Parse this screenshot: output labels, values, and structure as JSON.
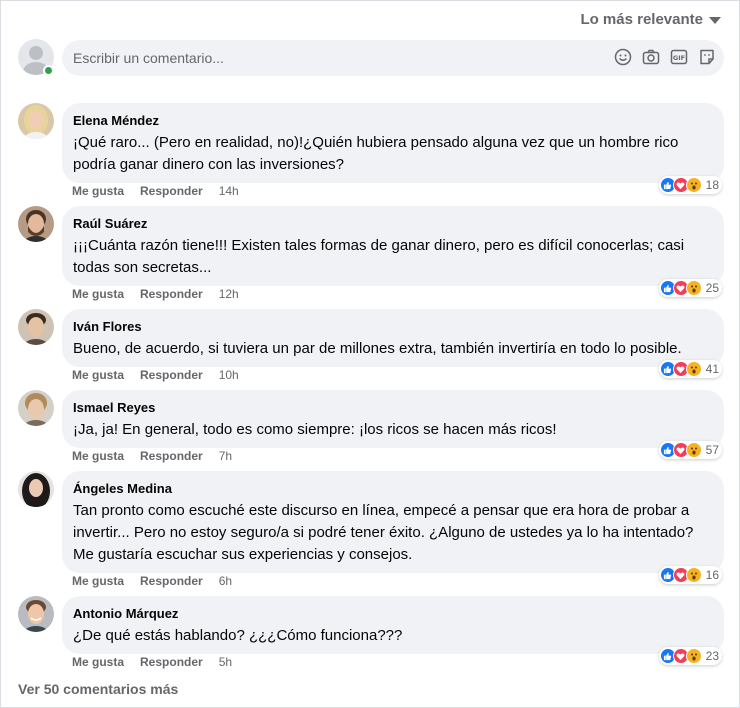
{
  "sort": {
    "label": "Lo más relevante"
  },
  "composer": {
    "placeholder": "Escribir un comentario..."
  },
  "actions": {
    "like": "Me gusta",
    "reply": "Responder"
  },
  "comments": [
    {
      "name": "Elena Méndez",
      "text": "¡Qué raro... (Pero en realidad, no)!¿Quién hubiera pensado alguna vez que un hombre rico podría ganar dinero con las inversiones?",
      "time": "14h",
      "reactions": "18",
      "avatar_bg": "#d9c7a8",
      "hair": "#e8d49a"
    },
    {
      "name": "Raúl Suárez",
      "text": "¡¡¡Cuánta razón tiene!!! Existen tales formas de ganar dinero, pero es difícil conocerlas; casi todas son secretas...",
      "time": "12h",
      "reactions": "25",
      "avatar_bg": "#b59b86",
      "hair": "#4a3324"
    },
    {
      "name": "Iván Flores",
      "text": "Bueno, de acuerdo, si tuviera un par de millones extra, también invertiría en todo lo posible.",
      "time": "10h",
      "reactions": "41",
      "avatar_bg": "#cfc3b6",
      "hair": "#3b2a20"
    },
    {
      "name": "Ismael Reyes",
      "text": "¡Ja, ja! En general, todo es como siempre: ¡los ricos se hacen más ricos!",
      "time": "7h",
      "reactions": "57",
      "avatar_bg": "#d4d0c8",
      "hair": "#b08a5a"
    },
    {
      "name": "Ángeles Medina",
      "text": "Tan pronto como escuché este discurso en línea, empecé a pensar que era hora de probar a invertir... Pero no estoy seguro/a si podré tener éxito. ¿Alguno de ustedes ya lo ha intentado? Me gustaría escuchar sus experiencias y consejos.",
      "time": "6h",
      "reactions": "16",
      "avatar_bg": "#e6e2e0",
      "hair": "#1e1a1a"
    },
    {
      "name": "Antonio Márquez",
      "text": "¿De qué estás hablando? ¿¿¿Cómo funciona???",
      "time": "5h",
      "reactions": "23",
      "avatar_bg": "#b8bcc0",
      "hair": "#6a4a30"
    }
  ],
  "more_comments": "Ver 50 comentarios más",
  "colors": {
    "like": "#1877f2",
    "love": "#f33e58",
    "wow": "#f7b125",
    "online": "#31a24c",
    "bubble": "#f0f2f5"
  }
}
